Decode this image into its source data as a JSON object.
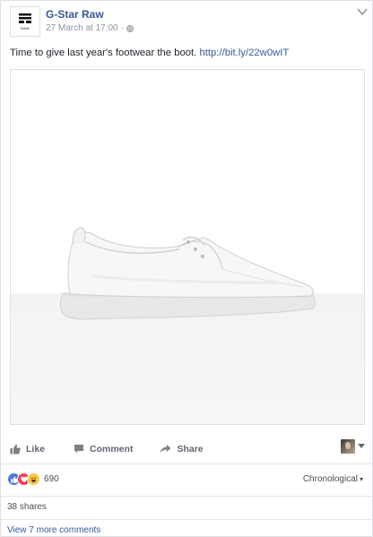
{
  "post": {
    "author": "G-Star Raw",
    "logo_text": "RAW",
    "date": "27 March at 17:00",
    "dot": "·",
    "text": "Time to give last year's footwear the boot.",
    "link": "http://bit.ly/22w0wIT",
    "media_icon": "white-shoe-photo"
  },
  "actions": {
    "like": "Like",
    "comment": "Comment",
    "share": "Share"
  },
  "reactions": {
    "types": [
      "like",
      "love",
      "haha"
    ],
    "count": "690",
    "sort_label": "Chronological",
    "sort_arrow": "▾"
  },
  "shares": "38 shares",
  "more_comments": "View 7 more comments",
  "colors": {
    "link": "#365899",
    "like": "#4a78d8",
    "love": "#ee3e5b",
    "haha": "#f7c94a"
  }
}
